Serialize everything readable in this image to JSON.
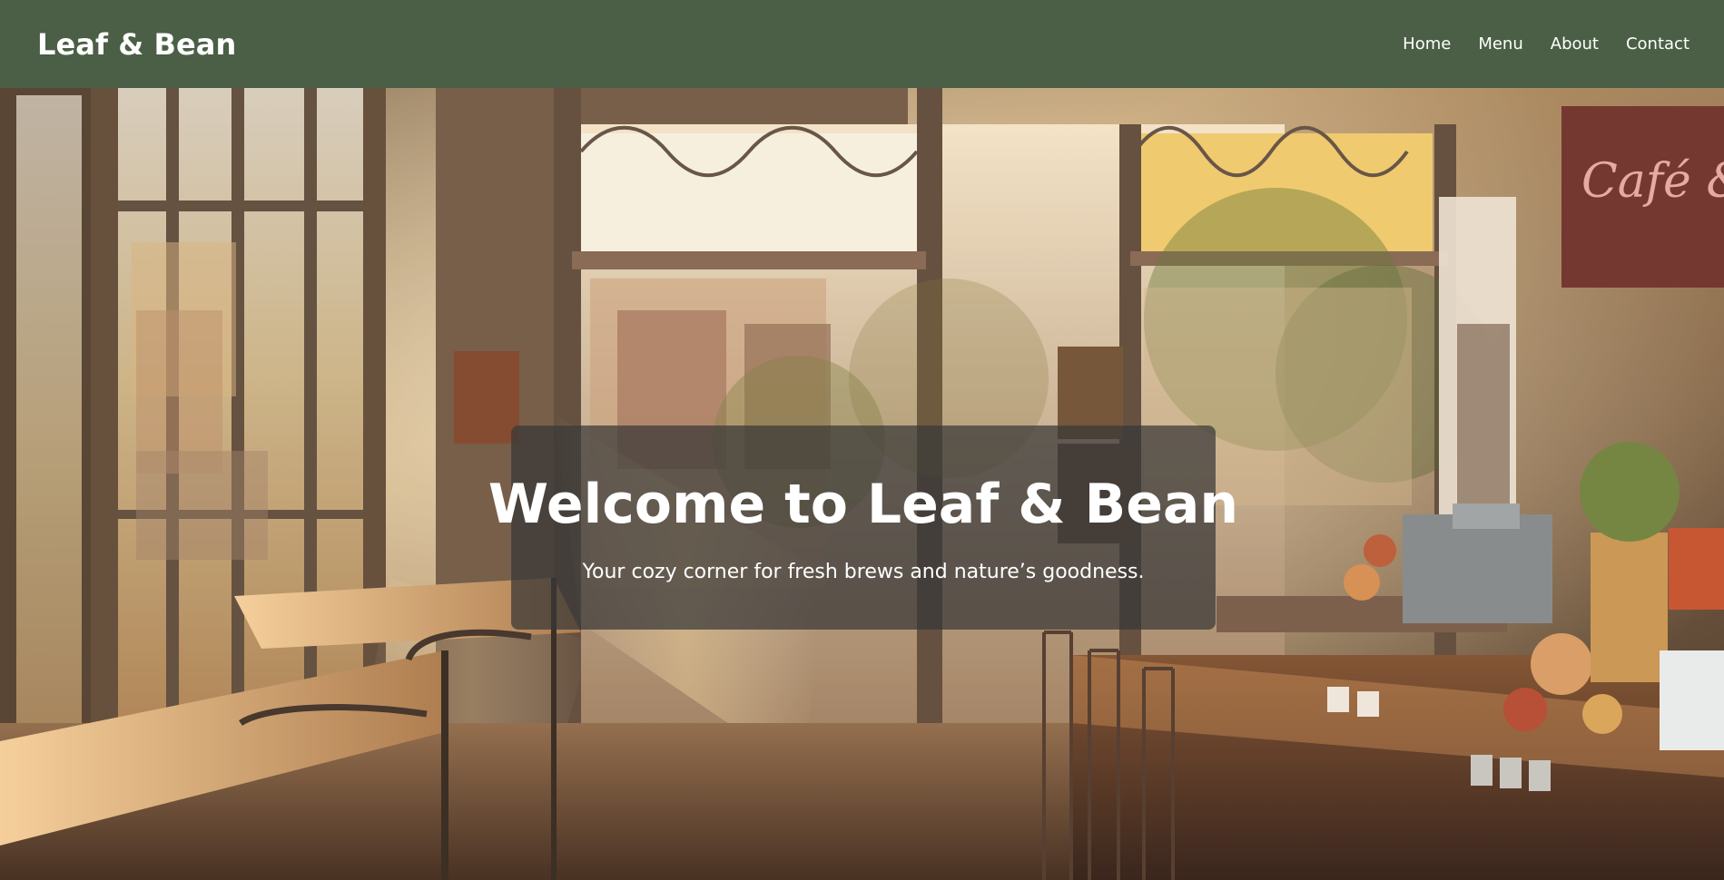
{
  "header": {
    "brand": "Leaf & Bean",
    "nav": [
      {
        "label": "Home"
      },
      {
        "label": "Menu"
      },
      {
        "label": "About"
      },
      {
        "label": "Contact"
      }
    ]
  },
  "hero": {
    "title": "Welcome to Leaf & Bean",
    "subtitle": "Your cozy corner for fresh brews and nature’s goodness.",
    "sign_text": "Café & B"
  },
  "colors": {
    "header_bg": "#4a5f45",
    "overlay_bg": "#383838",
    "text": "#ffffff"
  }
}
